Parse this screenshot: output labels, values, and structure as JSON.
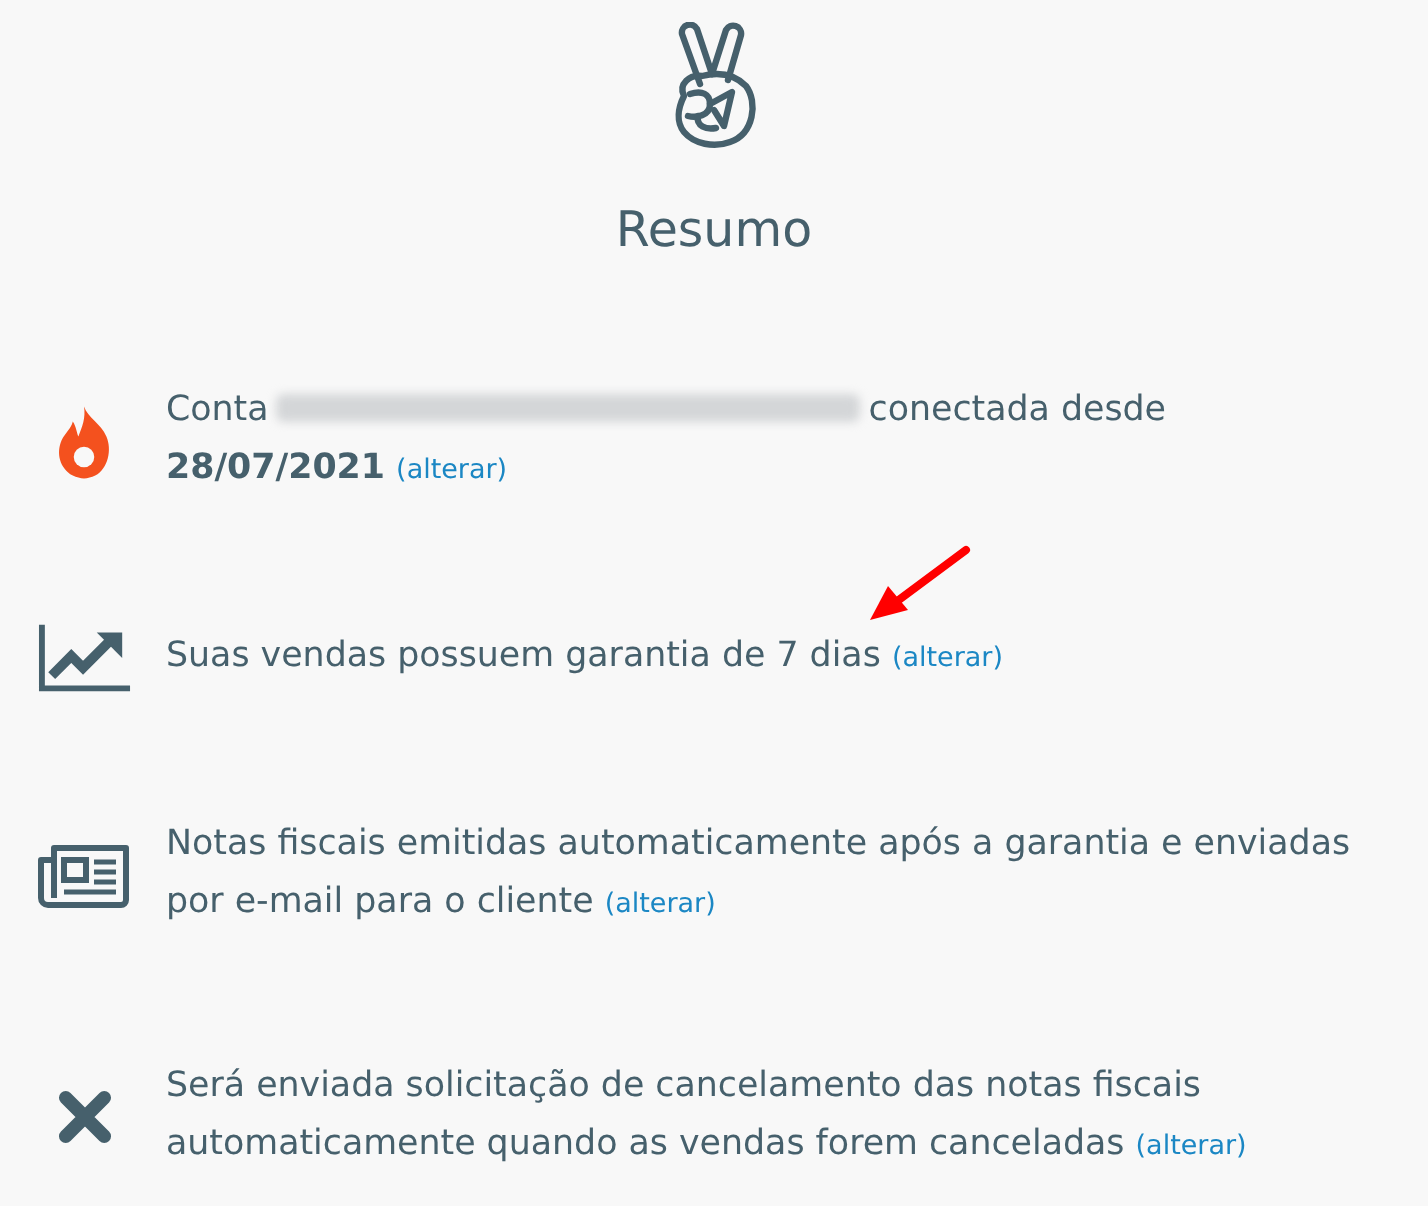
{
  "header": {
    "title": "Resumo"
  },
  "items": [
    {
      "kind": "account",
      "lead": "Conta",
      "redacted": true,
      "text": "conectada desde **28/07/2021**",
      "link": "(alterar)"
    },
    {
      "kind": "warranty",
      "text": "Suas vendas possuem garantia de 7 dias",
      "link": "(alterar)",
      "annotated": true
    },
    {
      "kind": "invoices",
      "text": "Notas fiscais emitidas automaticamente após a garantia e enviadas por e-mail para o cliente",
      "link": "(alterar)"
    },
    {
      "kind": "cancellation",
      "text": "Será enviada solicitação de cancelamento das notas fiscais automaticamente quando as vendas forem canceladas",
      "link": "(alterar)"
    }
  ]
}
